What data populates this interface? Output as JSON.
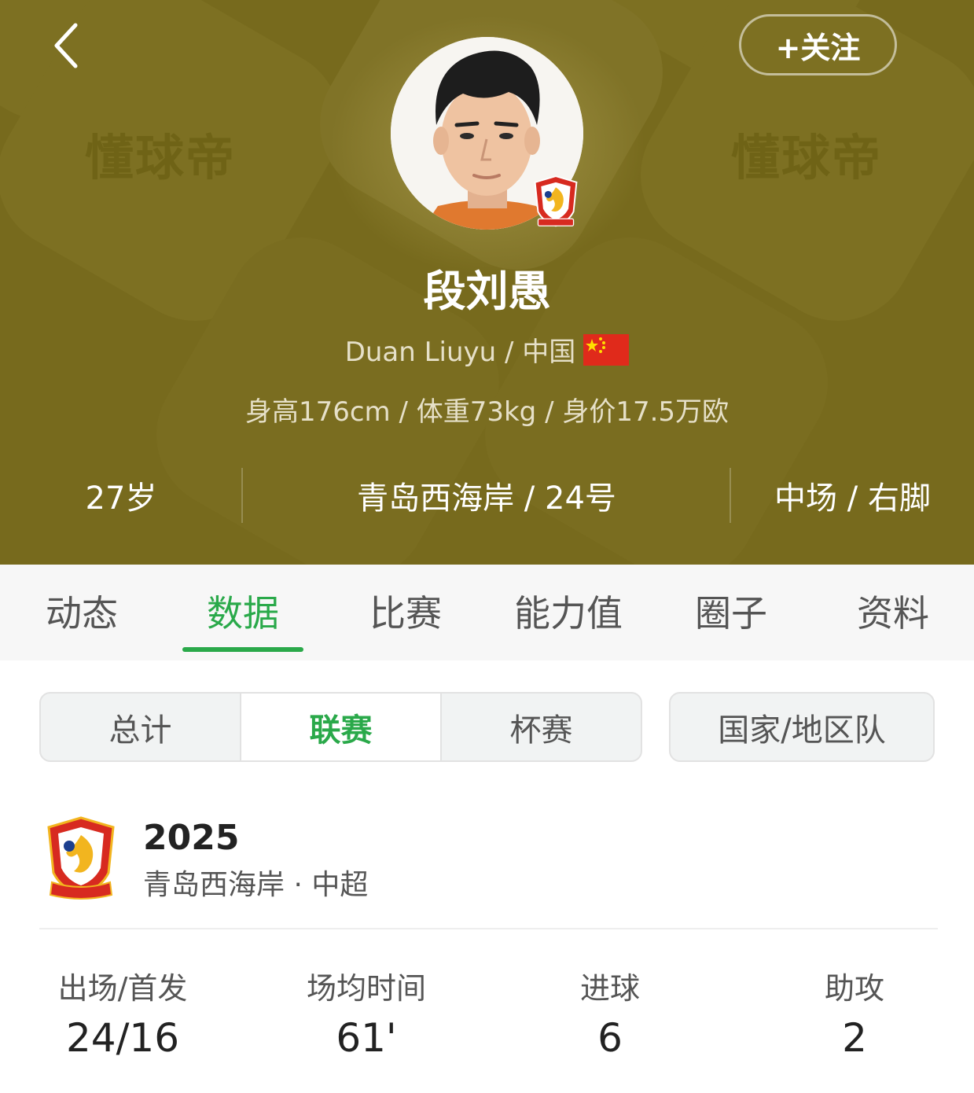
{
  "header": {
    "watermark": "懂球帝",
    "follow_label": "+关注",
    "player_name": "段刘愚",
    "name_en": "Duan Liuyu",
    "nationality": "中国",
    "body_info": "身高176cm / 体重73kg / 身价17.5万欧",
    "age": "27岁",
    "team_number": "青岛西海岸 / 24号",
    "position_foot": "中场 / 右脚",
    "bg_color": "#776a1d"
  },
  "tabs": [
    {
      "label": "动态"
    },
    {
      "label": "数据",
      "active": true
    },
    {
      "label": "比赛"
    },
    {
      "label": "能力值"
    },
    {
      "label": "圈子"
    },
    {
      "label": "资料"
    }
  ],
  "filters": {
    "options": [
      {
        "label": "总计"
      },
      {
        "label": "联赛",
        "active": true
      },
      {
        "label": "杯赛"
      }
    ],
    "national_label": "国家/地区队"
  },
  "season": {
    "year": "2025",
    "team_league": "青岛西海岸 · 中超",
    "stats": [
      {
        "label": "出场/首发",
        "value": "24/16"
      },
      {
        "label": "场均时间",
        "value": "61'"
      },
      {
        "label": "进球",
        "value": "6"
      },
      {
        "label": "助攻",
        "value": "2"
      }
    ]
  },
  "accent_color": "#2aa94a"
}
